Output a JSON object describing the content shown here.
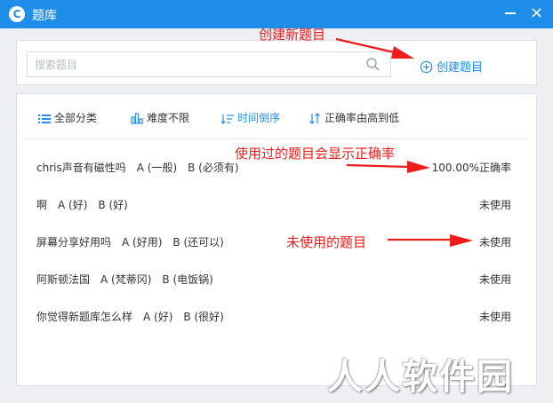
{
  "window": {
    "title": "题库",
    "logo_letter": "C",
    "accent_color": "#1e8ee8"
  },
  "search": {
    "placeholder": "搜索题目",
    "value": "",
    "icon": "search-icon"
  },
  "create_button": {
    "label": "创建题目",
    "icon": "plus-circle-icon"
  },
  "filters": [
    {
      "label": "全部分类",
      "icon": "list-icon"
    },
    {
      "label": "难度不限",
      "icon": "bar-chart-icon"
    },
    {
      "label": "时间倒序",
      "icon": "sort-time-icon",
      "active": true
    },
    {
      "label": "正确率由高到低",
      "icon": "sort-arrows-icon"
    }
  ],
  "questions": [
    {
      "text": "chris声音有磁性吗",
      "options": [
        "A (一般)",
        "B (必须有)"
      ],
      "status": "100.00%正确率"
    },
    {
      "text": "啊",
      "options": [
        "A (好)",
        "B (好)"
      ],
      "status": "未使用"
    },
    {
      "text": "屏幕分享好用吗",
      "options": [
        "A (好用)",
        "B (还可以)"
      ],
      "status": "未使用"
    },
    {
      "text": "阿斯顿法国",
      "options": [
        "A (梵蒂冈)",
        "B (电饭锅)"
      ],
      "status": "未使用"
    },
    {
      "text": "你觉得新题库怎么样",
      "options": [
        "A (好)",
        "B (很好)"
      ],
      "status": "未使用"
    }
  ],
  "annotations": {
    "create": "创建新题目",
    "used": "使用过的题目会显示正确率",
    "unused": "未使用的题目",
    "color": "#ee1c1c"
  },
  "watermark": "人人软件园"
}
